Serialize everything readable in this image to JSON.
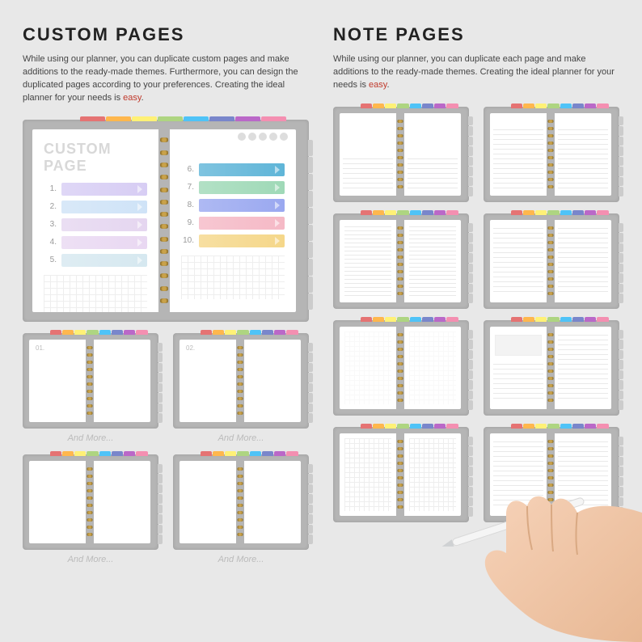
{
  "headings": {
    "custom": "CUSTOM PAGES",
    "note": "NOTE PAGES"
  },
  "descriptions": {
    "custom_a": "While using our planner, you can duplicate custom pages and make additions to the ready-made themes. Furthermore, you can design the duplicated pages according to your preferences. Creating the ideal planner for your needs is ",
    "note_a": "While using our planner, you can duplicate each page and make additions to the ready-made themes. Creating the ideal planner for your needs is ",
    "easy": "easy",
    "period": "."
  },
  "custom_page": {
    "title": "CUSTOM PAGE",
    "left": [
      {
        "n": "1.",
        "color": "#d7cdf4"
      },
      {
        "n": "2.",
        "color": "#cfe3f7"
      },
      {
        "n": "3.",
        "color": "#e5d6f0"
      },
      {
        "n": "4.",
        "color": "#e9d8f2"
      },
      {
        "n": "5.",
        "color": "#d6e8f0"
      }
    ],
    "right": [
      {
        "n": "6.",
        "color": "#5fb5d8"
      },
      {
        "n": "7.",
        "color": "#9fd9b7"
      },
      {
        "n": "8.",
        "color": "#9aa8f0"
      },
      {
        "n": "9.",
        "color": "#f5b9c6"
      },
      {
        "n": "10.",
        "color": "#f5d78a"
      }
    ]
  },
  "captions": {
    "more": "And More..."
  },
  "thumb_labels": {
    "c1": "01.",
    "c2": "02."
  }
}
